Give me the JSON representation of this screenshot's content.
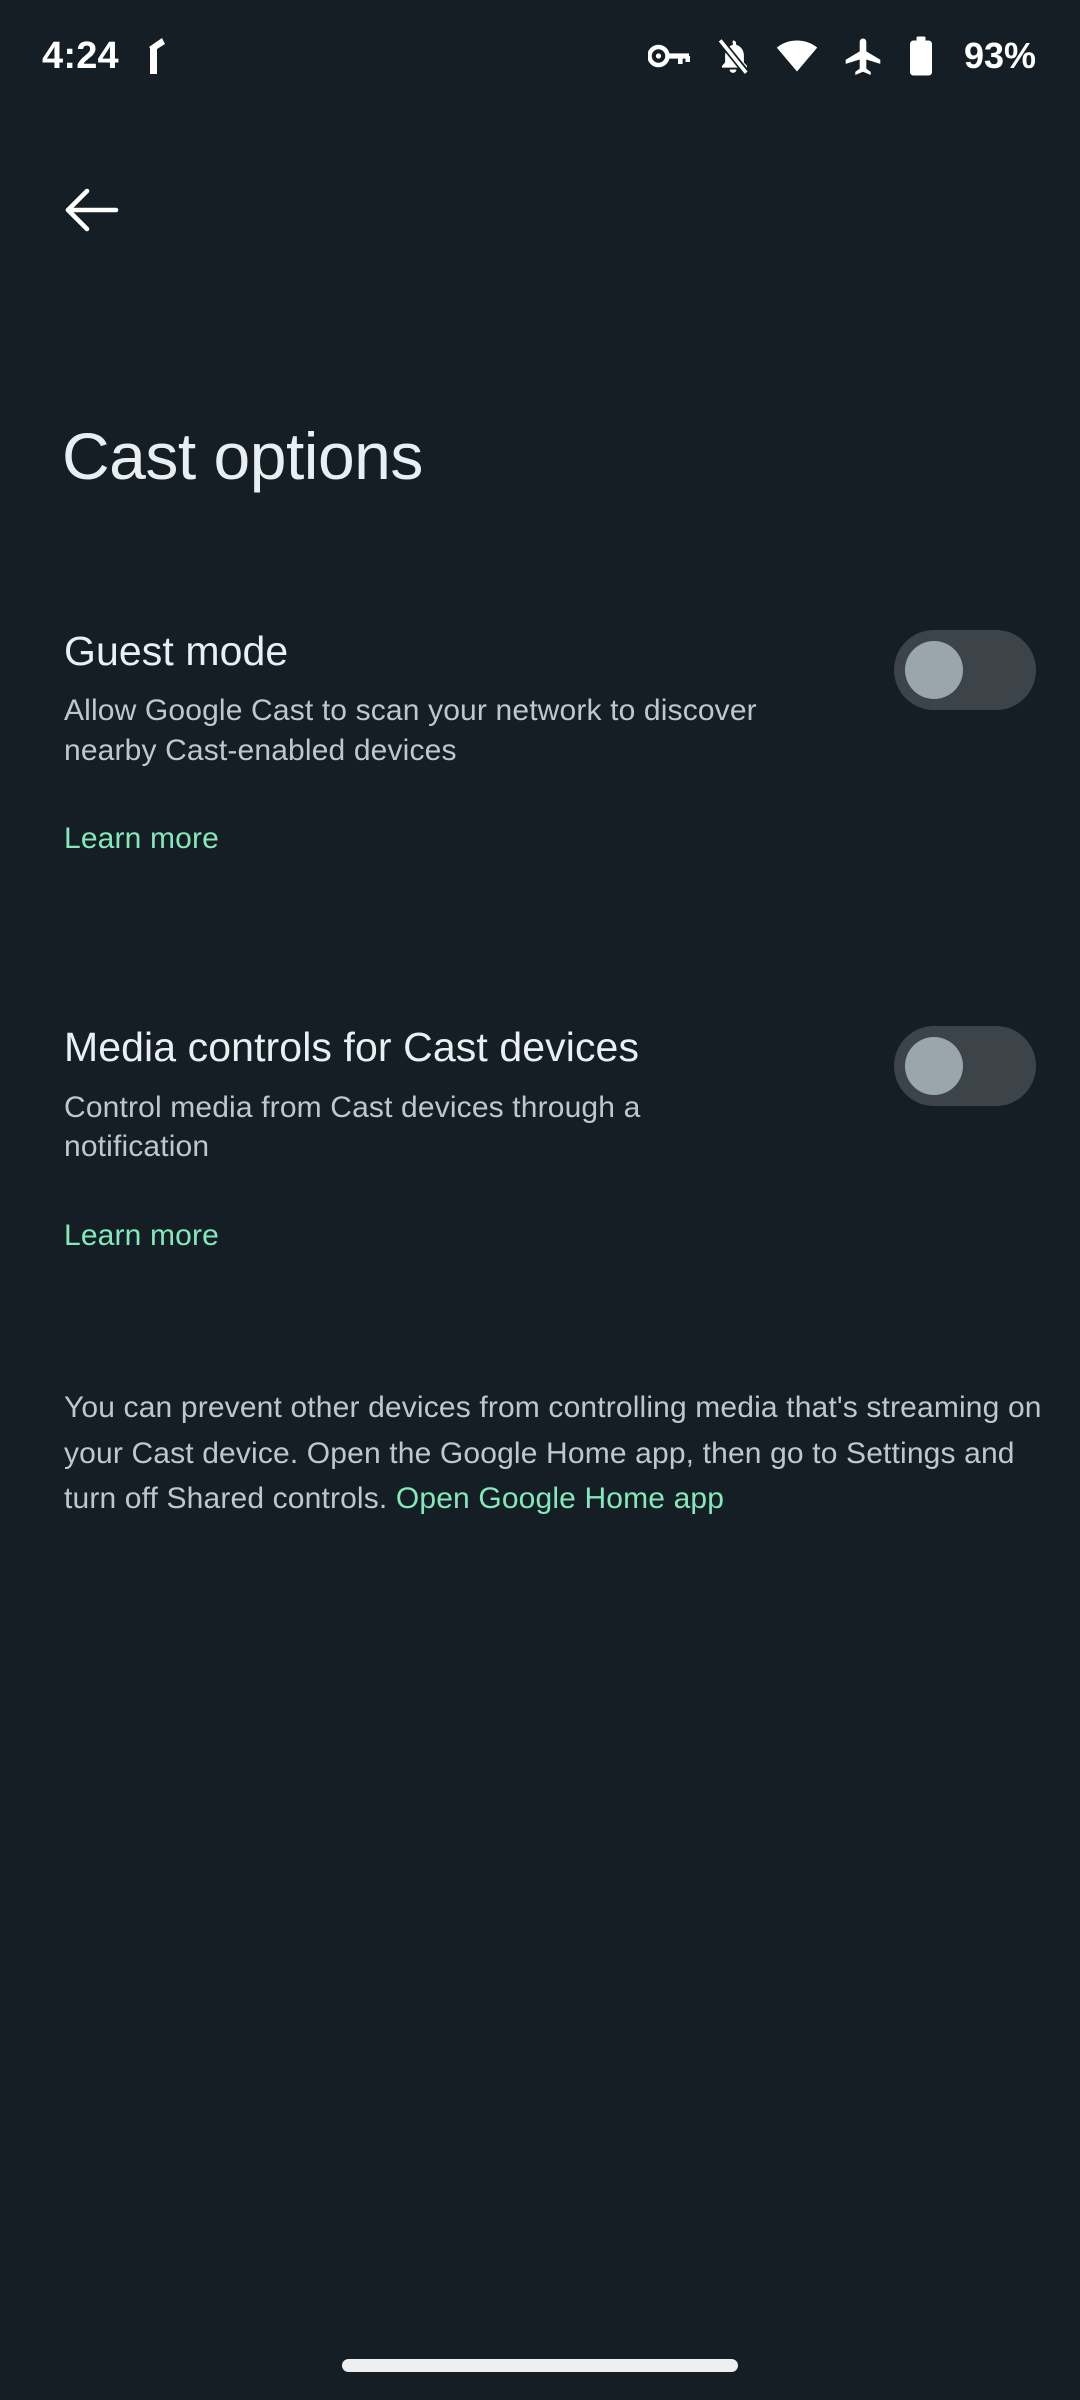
{
  "status_bar": {
    "time": "4:24",
    "battery_percent": "93%",
    "icons": {
      "notification": "notification-glyph-icon",
      "vpn": "vpn-key-icon",
      "notifications_off": "bell-off-icon",
      "wifi": "wifi-icon",
      "airplane": "airplane-mode-icon",
      "battery": "battery-icon"
    }
  },
  "appbar": {
    "back_label": "back-arrow"
  },
  "page": {
    "title": "Cast options"
  },
  "preferences": [
    {
      "title": "Guest mode",
      "summary": "Allow Google Cast to scan your network to discover nearby Cast-enabled devices",
      "link_label": "Learn more",
      "switch_state": "off"
    },
    {
      "title": "Media controls for Cast devices",
      "summary": "Control media from Cast devices through a notification",
      "link_label": "Learn more",
      "switch_state": "off"
    }
  ],
  "footer": {
    "text_before_link": "You can prevent other devices from controlling media that's streaming on your Cast device. Open the Google Home app, then go to Settings and turn off Shared controls. ",
    "link_label": "Open Google Home app"
  },
  "colors": {
    "background": "#151E24",
    "accent_link": "#83E8BA",
    "primary_text": "#E9EFF3",
    "secondary_text": "#BDC8CC",
    "switch_track_off": "#3C4449",
    "switch_thumb_off": "#9BA6AC"
  }
}
